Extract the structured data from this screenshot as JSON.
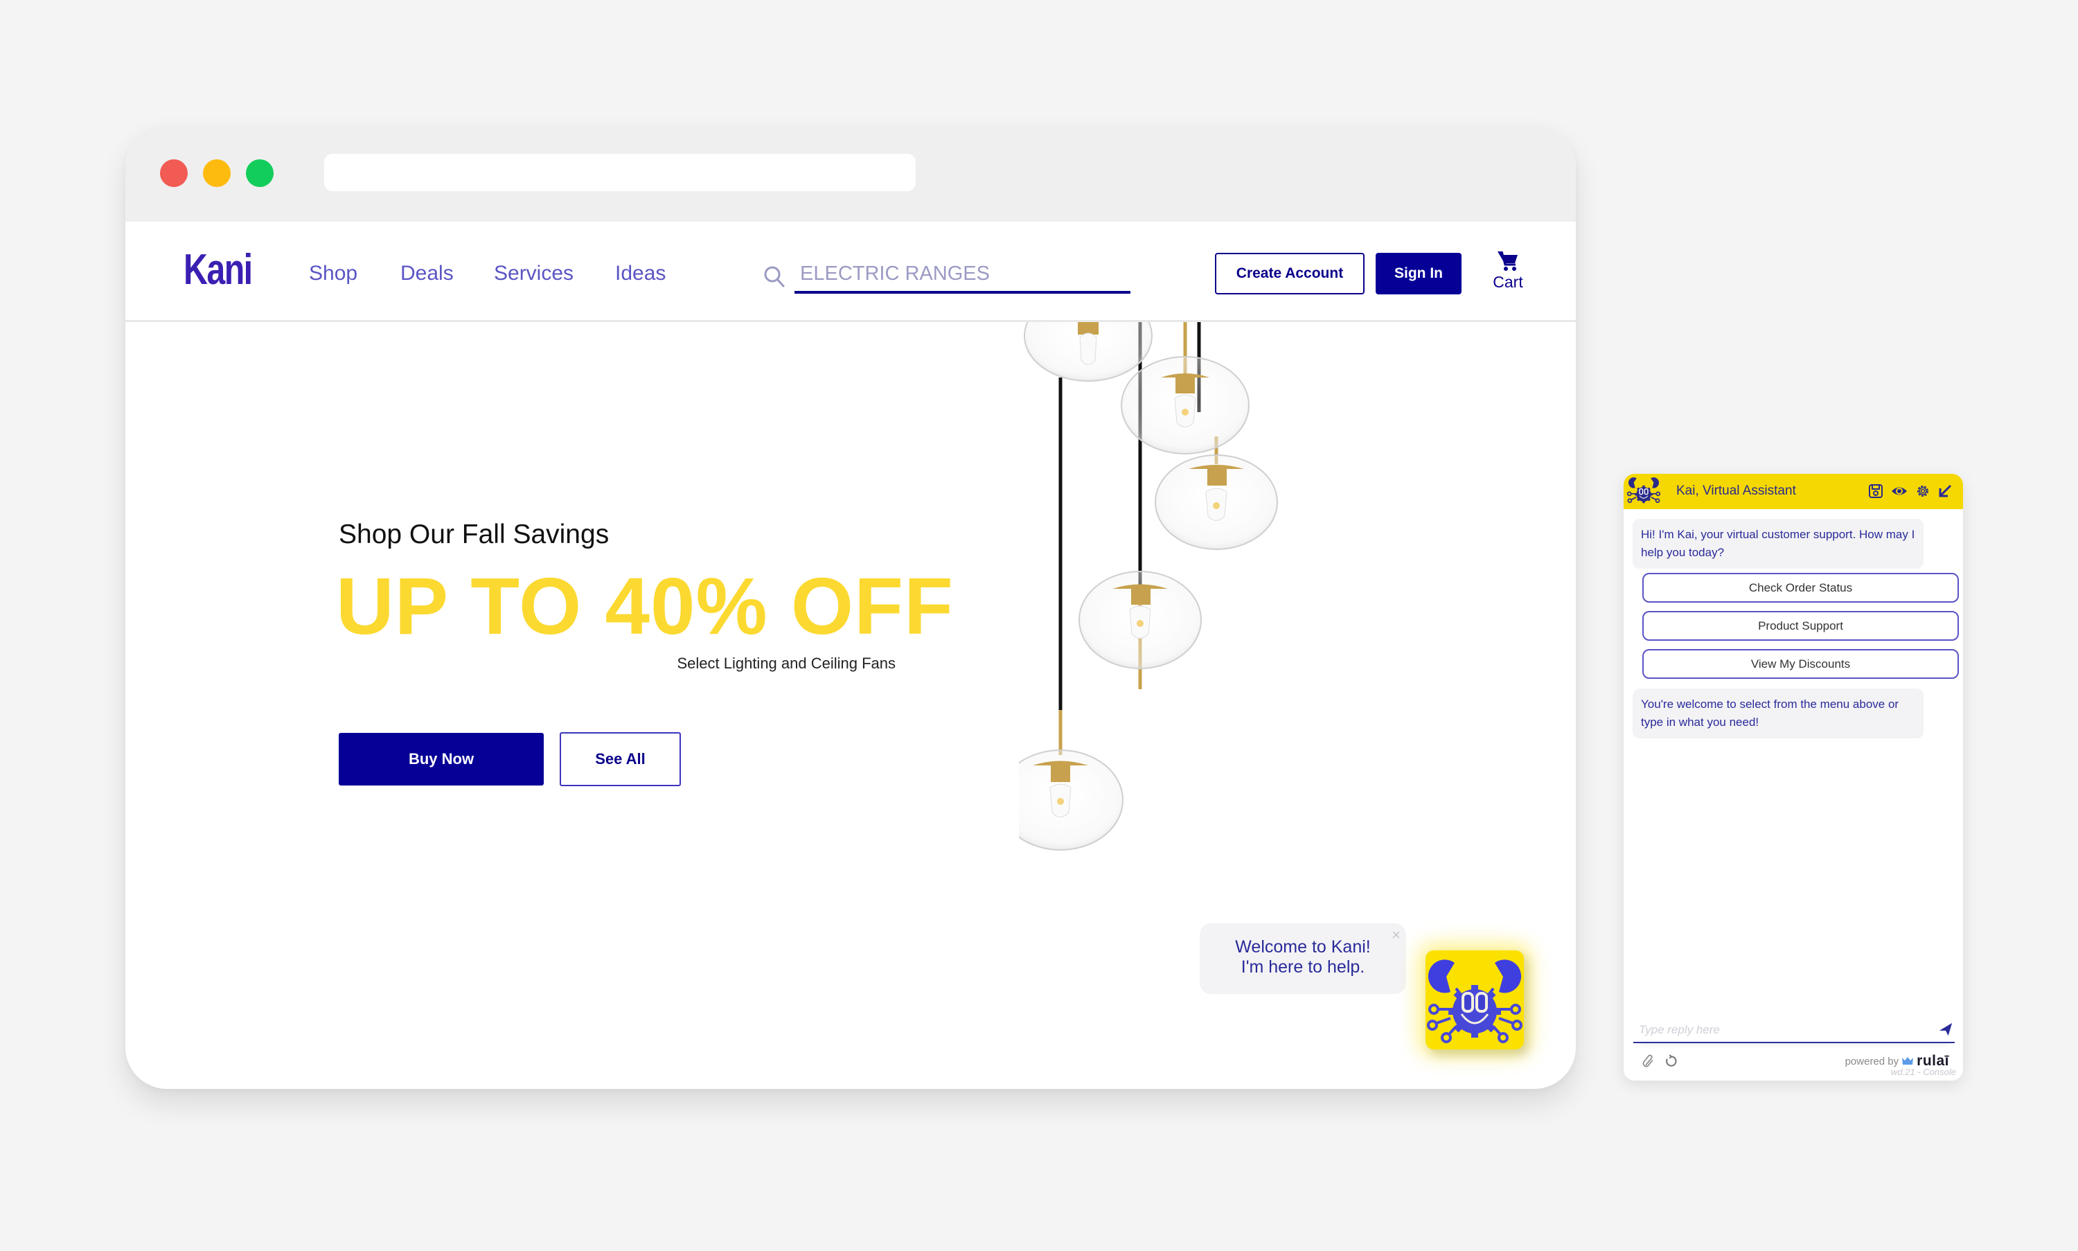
{
  "colors": {
    "brand_primary": "#060096",
    "brand_yellow": "#fcd930",
    "nav_link": "#5a55c4",
    "chat_header": "#f5d800",
    "chat_text": "#2a2a9a",
    "page_background": "#f4f4f4"
  },
  "browser": {
    "traffic_lights": [
      "close",
      "minimize",
      "maximize"
    ],
    "url": ""
  },
  "site": {
    "logo": "Kani",
    "nav": [
      {
        "label": "Shop"
      },
      {
        "label": "Deals"
      },
      {
        "label": "Services"
      },
      {
        "label": "Ideas"
      }
    ],
    "search": {
      "icon": "search-icon",
      "value": "",
      "placeholder": "ELECTRIC RANGES"
    },
    "create_account_label": "Create Account",
    "sign_in_label": "Sign In",
    "cart": {
      "icon": "cart-icon",
      "label": "Cart"
    }
  },
  "hero": {
    "eyebrow": "Shop Our Fall Savings",
    "headline": "UP TO 40% OFF",
    "subtitle": "Select Lighting and Ceiling Fans",
    "buy_now_label": "Buy Now",
    "see_all_label": "See All",
    "image": "pendant-lights-image"
  },
  "welcome_popup": {
    "line1": "Welcome to Kani!",
    "line2": "I'm here to help.",
    "close_icon": "close-icon"
  },
  "chat": {
    "title": "Kai, Virtual Assistant",
    "header_icons": [
      "save-icon",
      "eye-icon",
      "gear-icon",
      "minimize-arrow-icon"
    ],
    "messages": [
      {
        "from": "bot",
        "text": "Hi! I'm Kai, your virtual customer support. How may I help you today?"
      },
      {
        "from": "bot",
        "text": "You're welcome to select from the menu above or type in what you need!"
      }
    ],
    "quick_replies": [
      {
        "label": "Check Order Status"
      },
      {
        "label": "Product Support"
      },
      {
        "label": "View My Discounts"
      }
    ],
    "input": {
      "value": "",
      "placeholder": "Type reply here"
    },
    "powered_by_label": "powered by",
    "powered_by_brand": "rulaī",
    "build_label": "wd.21 - Console"
  }
}
